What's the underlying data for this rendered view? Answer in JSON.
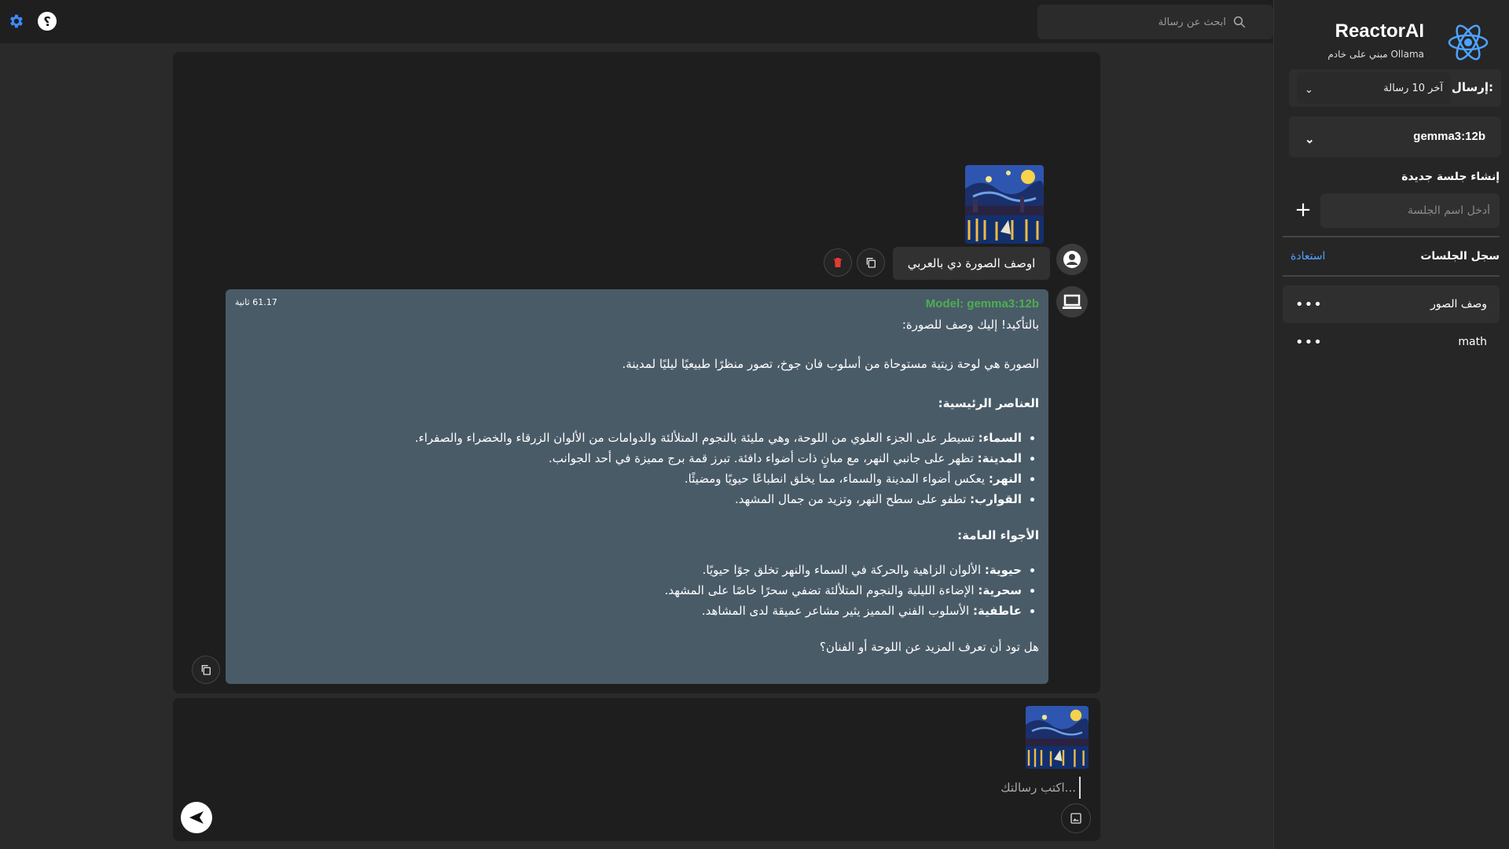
{
  "header": {
    "search_placeholder": "ابحث عن رسالة",
    "icons": [
      "gear-icon",
      "help-icon",
      "search-icon"
    ]
  },
  "sidebar": {
    "brand_title": "ReactorAI",
    "brand_subtitle": "مبني على خادم Ollama",
    "send_label": "إرسال:",
    "send_option": "آخر 10 رسالة",
    "model_option": "gemma3:12b",
    "new_session_title": "إنشاء جلسة جديدة",
    "session_name_placeholder": "أدخل اسم الجلسة",
    "history_title": "سجل الجلسات",
    "restore_label": "استعادة",
    "sessions": [
      {
        "name": "وصف الصور",
        "active": true
      },
      {
        "name": "math",
        "active": false
      }
    ]
  },
  "chat": {
    "user_message": "اوصف الصورة دي بالعربي",
    "ai": {
      "model_label": "Model: gemma3:12b",
      "duration": "61.17 ثانية",
      "intro": "بالتأكيد! إليك وصف للصورة:",
      "summary": "الصورة هي لوحة زيتية مستوحاة من أسلوب فان جوخ، تصور منظرًا طبيعيًا ليليًا لمدينة.",
      "section1_title": "العناصر الرئيسية:",
      "section1_items": [
        {
          "term": "السماء:",
          "text": " تسيطر على الجزء العلوي من اللوحة، وهي مليئة بالنجوم المتلألئة والدوامات من الألوان الزرقاء والخضراء والصفراء."
        },
        {
          "term": "المدينة:",
          "text": " تظهر على جانبي النهر، مع مبانٍ ذات أضواء دافئة. تبرز قمة برج مميزة في أحد الجوانب."
        },
        {
          "term": "النهر:",
          "text": " يعكس أضواء المدينة والسماء، مما يخلق انطباعًا حيويًا ومضيئًا."
        },
        {
          "term": "القوارب:",
          "text": " تطفو على سطح النهر، وتزيد من جمال المشهد."
        }
      ],
      "section2_title": "الأجواء العامة:",
      "section2_items": [
        {
          "term": "حيوية:",
          "text": " الألوان الزاهية والحركة في السماء والنهر تخلق جوًا حيويًا."
        },
        {
          "term": "سحرية:",
          "text": " الإضاءة الليلية والنجوم المتلألئة تضفي سحرًا خاصًا على المشهد."
        },
        {
          "term": "عاطفية:",
          "text": " الأسلوب الفني المميز يثير مشاعر عميقة لدى المشاهد."
        }
      ],
      "closing": "هل تود أن تعرف المزيد عن اللوحة أو الفنان؟"
    }
  },
  "composer": {
    "placeholder": "اكتب رسالتك..."
  },
  "colors": {
    "accent_blue": "#4ea2ff",
    "model_green": "#4caf50",
    "ai_bubble": "#4a5b68",
    "delete_red": "#e53935"
  }
}
